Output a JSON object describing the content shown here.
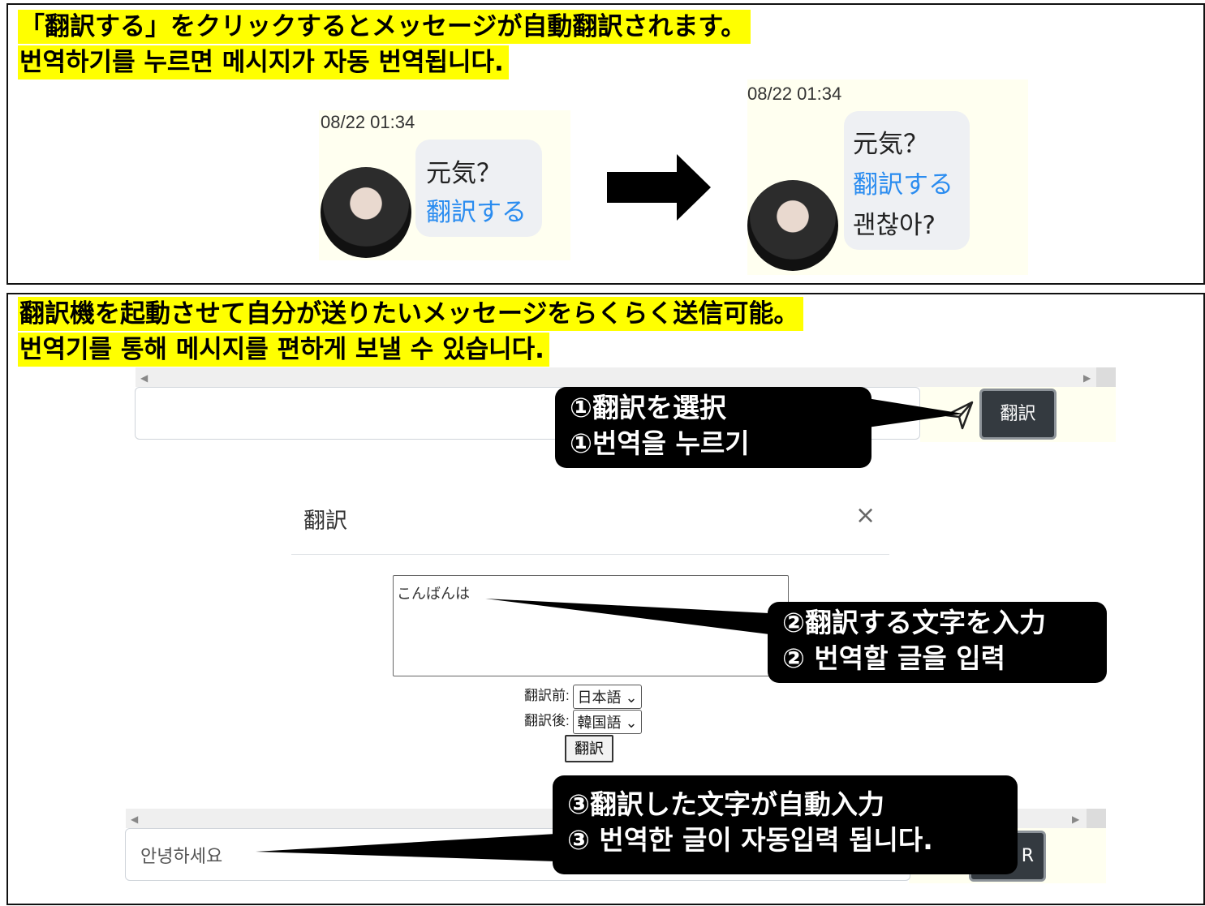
{
  "top": {
    "heading_jp": "「翻訳する」をクリックするとメッセージが自動翻訳されます。",
    "heading_kr": "번역하기를 누르면 메시지가 자동 번역됩니다.",
    "before": {
      "timestamp": "08/22 01:34",
      "message": "元気？",
      "translate_link": "翻訳する"
    },
    "after": {
      "timestamp": "08/22 01:34",
      "message": "元気？",
      "translate_link": "翻訳する",
      "translated": "괜찮아?"
    }
  },
  "bottom": {
    "heading_jp": "翻訳機を起動させて自分が送りたいメッセージをらくらく送信可能。",
    "heading_kr": "번역기를 통해 메시지를 편하게 보낼 수 있습니다.",
    "translate_button": "翻訳",
    "callout1": {
      "line1": "①翻訳を選択",
      "line2": "①번역을 누르기"
    },
    "modal": {
      "title": "翻訳",
      "close": "×",
      "textarea_value": "こんばんは",
      "before_label": "翻訳前:",
      "before_lang": "日本語",
      "after_label": "翻訳後:",
      "after_lang": "韓国語",
      "submit": "翻訳"
    },
    "callout2": {
      "line1": "②翻訳する文字を入力",
      "line2": "② 번역할 글을 입력"
    },
    "callout3": {
      "line1": "③翻訳した文字が自動入力",
      "line2": "③ 번역한 글이 자동입력 됩니다."
    },
    "result_input_value": "안녕하세요",
    "partial_button_char": "R"
  }
}
